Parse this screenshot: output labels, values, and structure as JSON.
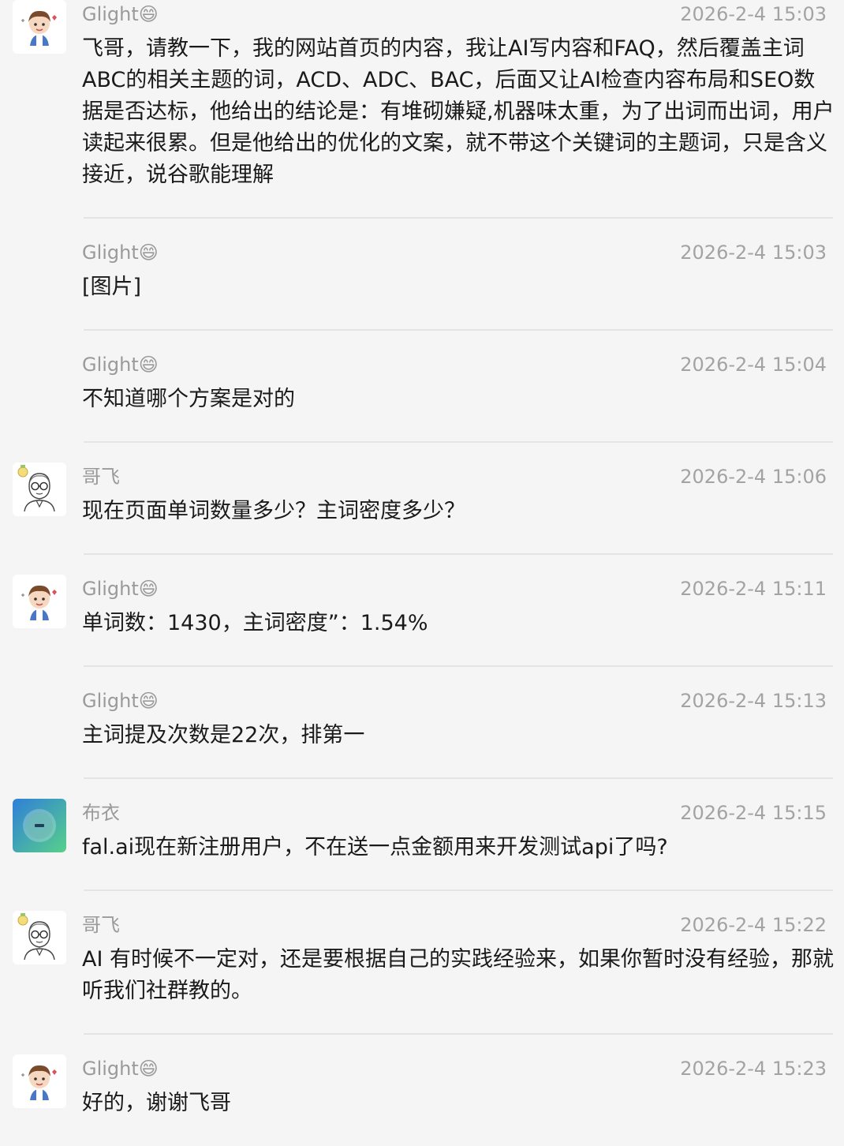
{
  "messages": [
    {
      "sender": "Glight",
      "emoji": "😄",
      "avatar": "cartoon-boy-avatar",
      "time": "2026-2-4 15:03",
      "text": "飞哥，请教一下，我的网站首页的内容，我让AI写内容和FAQ，然后覆盖主词 ABC的相关主题的词，ACD、ADC、BAC，后面又让AI检查内容布局和SEO数据是否达标，他给出的结论是：有堆砌嫌疑,机器味太重，为了出词而出词，用户读起来很累。但是他给出的优化的文案，就不带这个关键词的主题词，只是含义接近，说谷歌能理解"
    },
    {
      "sender": "Glight",
      "emoji": "😄",
      "avatar": "",
      "time": "2026-2-4 15:03",
      "text": "[图片]"
    },
    {
      "sender": "Glight",
      "emoji": "😄",
      "avatar": "",
      "time": "2026-2-4 15:04",
      "text": "不知道哪个方案是对的"
    },
    {
      "sender": "哥飞",
      "emoji": "",
      "avatar": "glasses-man-avatar",
      "time": "2026-2-4 15:06",
      "text": "现在页面单词数量多少？主词密度多少？"
    },
    {
      "sender": "Glight",
      "emoji": "😄",
      "avatar": "cartoon-boy-avatar",
      "time": "2026-2-4 15:11",
      "text": "单词数：1430，主词密度”：1.54%"
    },
    {
      "sender": "Glight",
      "emoji": "😄",
      "avatar": "",
      "time": "2026-2-4 15:13",
      "text": "主词提及次数是22次，排第一"
    },
    {
      "sender": "布衣",
      "emoji": "",
      "avatar": "gradient-circle-avatar",
      "time": "2026-2-4 15:15",
      "text": "fal.ai现在新注册用户，不在送一点金额用来开发测试api了吗?"
    },
    {
      "sender": "哥飞",
      "emoji": "",
      "avatar": "glasses-man-avatar",
      "time": "2026-2-4 15:22",
      "text": "AI 有时候不一定对，还是要根据自己的实践经验来，如果你暂时没有经验，那就听我们社群教的。"
    },
    {
      "sender": "Glight",
      "emoji": "😄",
      "avatar": "cartoon-boy-avatar",
      "time": "2026-2-4 15:23",
      "text": "好的，谢谢飞哥"
    }
  ]
}
